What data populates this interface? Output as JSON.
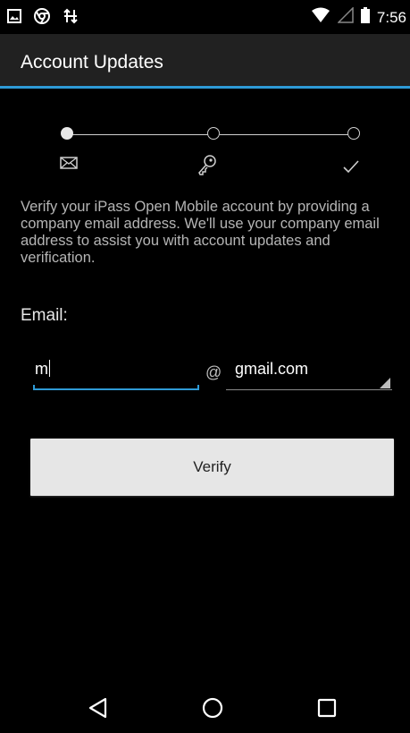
{
  "status_bar": {
    "left_icons": [
      "image-notification-icon",
      "chrome-icon",
      "sync-icon"
    ],
    "right_icons": [
      "wifi-icon",
      "signal-icon",
      "battery-icon"
    ],
    "time": "7:56"
  },
  "action_bar": {
    "title": "Account Updates"
  },
  "stepper": {
    "steps": [
      {
        "icon": "mail-icon",
        "state": "current"
      },
      {
        "icon": "key-icon",
        "state": "pending"
      },
      {
        "icon": "check-icon",
        "state": "pending"
      }
    ]
  },
  "description": "Verify your iPass Open Mobile account by providing a company email address. We'll use your company email address to assist you with account updates and verification.",
  "email": {
    "label": "Email:",
    "value": "m",
    "at": "@",
    "domain": "gmail.com"
  },
  "verify_button": {
    "label": "Verify"
  },
  "nav_bar": {
    "buttons": [
      "back-icon",
      "home-icon",
      "recents-icon"
    ]
  },
  "colors": {
    "accent": "#2e9ad6",
    "action_bar": "#212121",
    "background": "#000000",
    "button": "#e6e6e6"
  }
}
